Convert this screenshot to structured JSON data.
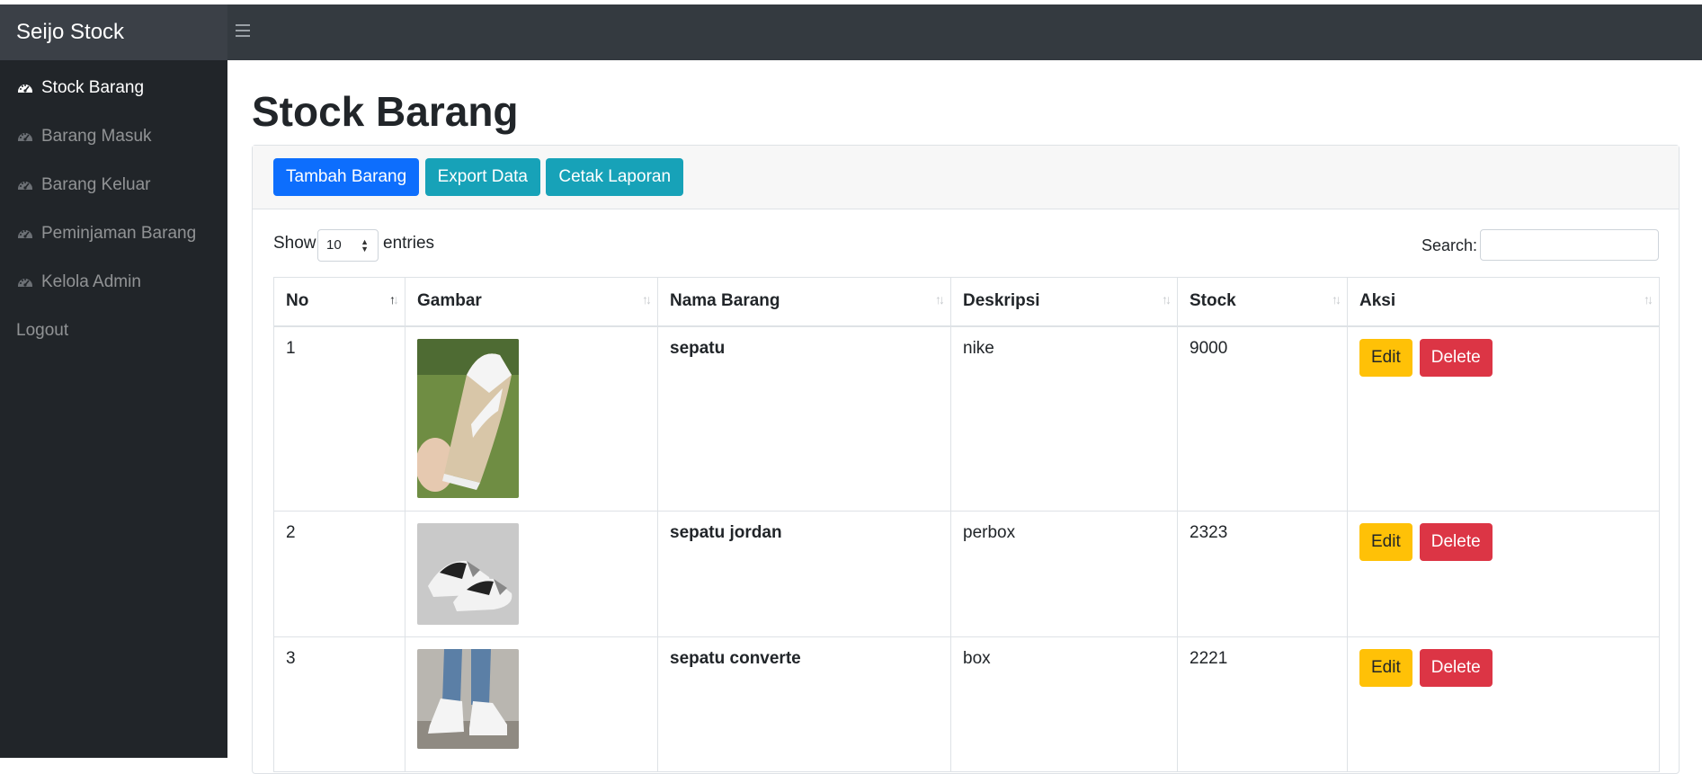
{
  "app": {
    "brand": "Seijo Stock"
  },
  "sidebar": {
    "items": [
      {
        "label": "Stock Barang",
        "icon": "tachometer-icon",
        "active": true
      },
      {
        "label": "Barang Masuk",
        "icon": "tachometer-icon",
        "active": false
      },
      {
        "label": "Barang Keluar",
        "icon": "tachometer-icon",
        "active": false
      },
      {
        "label": "Peminjaman Barang",
        "icon": "tachometer-icon",
        "active": false
      },
      {
        "label": "Kelola Admin",
        "icon": "tachometer-icon",
        "active": false
      }
    ],
    "logout": "Logout"
  },
  "page": {
    "title": "Stock Barang"
  },
  "toolbar": {
    "add_label": "Tambah Barang",
    "export_label": "Export Data",
    "print_label": "Cetak Laporan"
  },
  "datatable": {
    "show_label": "Show",
    "entries_value": "10",
    "entries_label": "entries",
    "search_label": "Search:",
    "columns": [
      "No",
      "Gambar",
      "Nama Barang",
      "Deskripsi",
      "Stock",
      "Aksi"
    ],
    "rows": [
      {
        "no": "1",
        "image": "beige-white-sneaker",
        "name": "sepatu",
        "description": "nike",
        "stock": "9000",
        "edit": "Edit",
        "delete": "Delete"
      },
      {
        "no": "2",
        "image": "black-grey-jordan-sneakers",
        "name": "sepatu jordan",
        "description": "perbox",
        "stock": "2323",
        "edit": "Edit",
        "delete": "Delete"
      },
      {
        "no": "3",
        "image": "white-high-top-sneakers",
        "name": "sepatu converte",
        "description": "box",
        "stock": "2221",
        "edit": "Edit",
        "delete": "Delete"
      }
    ]
  },
  "colors": {
    "navbar": "#343a40",
    "sidebar": "#212529",
    "primary": "#0d6efd",
    "info": "#17a2b8",
    "warning": "#ffc107",
    "danger": "#dc3545"
  }
}
